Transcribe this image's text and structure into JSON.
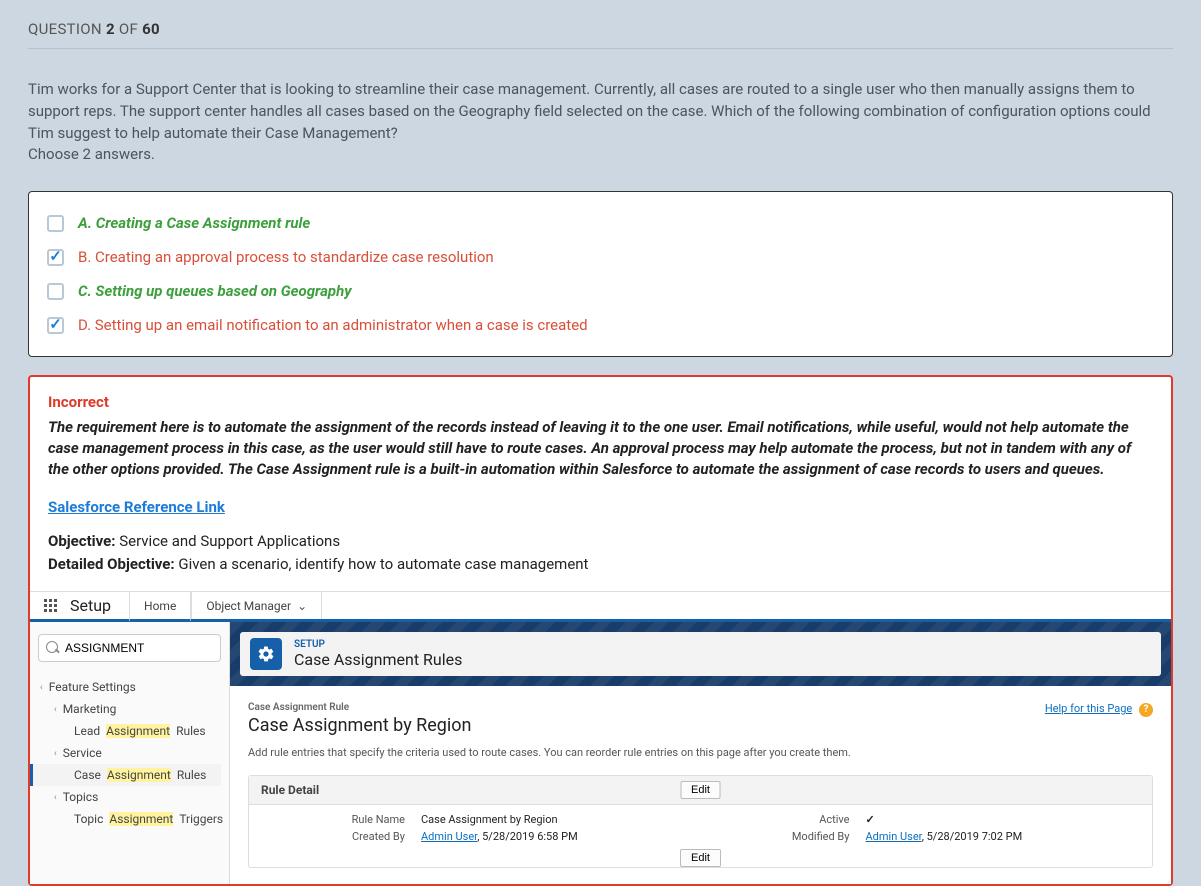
{
  "question": {
    "label_prefix": "QUESTION ",
    "number": "2",
    "of_label": " OF ",
    "total": "60",
    "body": "Tim works for a Support Center that is looking to streamline their case management. Currently, all cases are routed to a single user who then manually assigns them to support reps. The support center handles all cases based on the Geography field selected on the case. Which of the following combination of configuration options could Tim suggest to help automate their Case Management?",
    "choose": "Choose 2 answers."
  },
  "answers": [
    {
      "text": "A. Creating a Case Assignment rule",
      "checked": false,
      "style": "correct"
    },
    {
      "text": "B. Creating an approval process to standardize case resolution",
      "checked": true,
      "style": "wrong"
    },
    {
      "text": "C. Setting up queues based on Geography",
      "checked": false,
      "style": "correct"
    },
    {
      "text": "D. Setting up an email notification to an administrator when a case is created",
      "checked": true,
      "style": "wrong"
    }
  ],
  "feedback": {
    "status": "Incorrect",
    "explain": "The requirement here is to automate the assignment of the records instead of leaving it to the one user. Email notifications, while useful, would not help automate the case management process in this case, as the user would still have to route cases. An approval process may help automate the process, but not in tandem with any of the other options provided. The Case Assignment rule is a built-in automation within Salesforce to automate the assignment of case records to users and queues.",
    "link_label": "Salesforce Reference Link",
    "objective_label": "Objective:",
    "objective_value": " Service and Support Applications",
    "detailed_label": "Detailed Objective:",
    "detailed_value": " Given a scenario, identify how to automate case management"
  },
  "sf": {
    "setup_label": "Setup",
    "tabs": {
      "home": "Home",
      "obj_mgr": "Object Manager"
    },
    "search_value": "ASSIGNMENT",
    "tree": {
      "feature": "Feature Settings",
      "marketing": "Marketing",
      "lead_pre": "Lead ",
      "lead_hl": "Assignment",
      "lead_post": " Rules",
      "service": "Service",
      "case_pre": "Case ",
      "case_hl": "Assignment",
      "case_post": " Rules",
      "topics": "Topics",
      "topic_pre": "Topic ",
      "topic_hl": "Assignment",
      "topic_post": " Triggers"
    },
    "hero": {
      "small": "SETUP",
      "large": "Case Assignment Rules"
    },
    "content": {
      "crumb": "Case Assignment Rule",
      "title": "Case Assignment by Region",
      "help": "Help for this Page",
      "desc": "Add rule entries that specify the criteria used to route cases. You can reorder rule entries on this page after you create them.",
      "panel_head": "Rule Detail",
      "edit": "Edit",
      "rule_name_k": "Rule Name",
      "rule_name_v": "Case Assignment by Region",
      "active_k": "Active",
      "created_k": "Created By",
      "created_user": "Admin User",
      "created_ts": ", 5/28/2019 6:58 PM",
      "modified_k": "Modified By",
      "modified_user": "Admin User",
      "modified_ts": ", 5/28/2019 7:02 PM"
    }
  }
}
